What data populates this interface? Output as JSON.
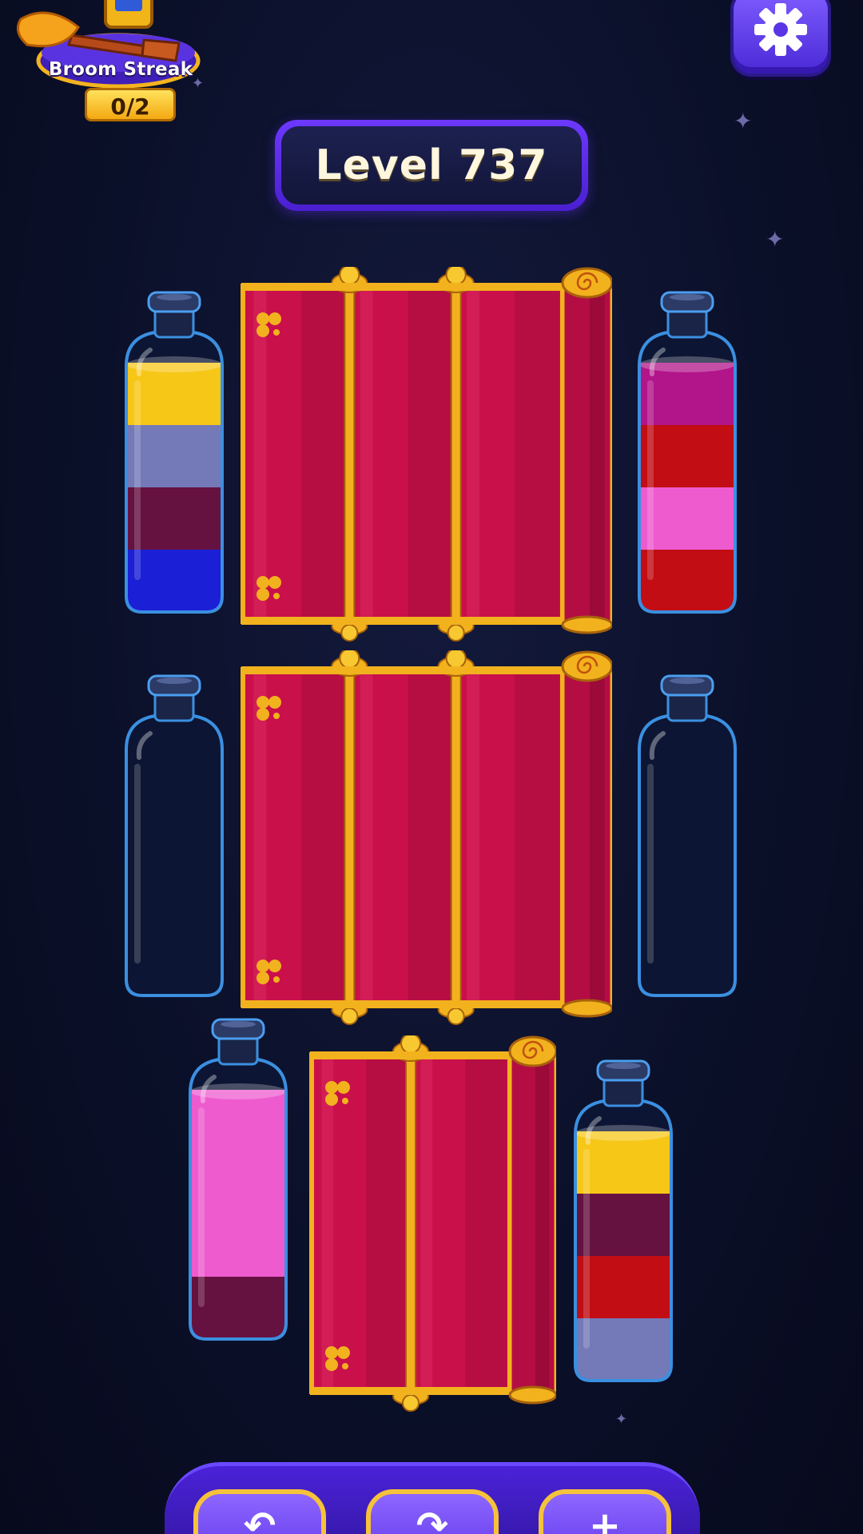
{
  "header": {
    "streak_label": "Broom Streak",
    "streak_count": "0/2",
    "level_label": "Level 737"
  },
  "icons": {
    "streak": "broom-icon",
    "settings": "gear-icon",
    "undo": "undo-arrow-icon",
    "shuffle": "redo-arrow-icon",
    "add": "add-bottle-icon"
  },
  "colors": {
    "yellow": "#f7c718",
    "lavender": "#7479b8",
    "plum": "#651240",
    "blue": "#1b1fd6",
    "magenta": "#b2148a",
    "red": "#c10d13",
    "pink": "#ee5bcf",
    "curtain": "#c9104a",
    "gold": "#f2b21e"
  },
  "bottles": [
    {
      "name": "bottle-top-left",
      "layers": [
        "yellow",
        "lavender",
        "plum",
        "blue"
      ]
    },
    {
      "name": "bottle-top-right",
      "layers": [
        "magenta",
        "red",
        "pink",
        "red"
      ]
    },
    {
      "name": "bottle-middle-left",
      "layers": []
    },
    {
      "name": "bottle-middle-right",
      "layers": []
    },
    {
      "name": "bottle-bottom-left",
      "layers": [
        "pink",
        "pink",
        "pink",
        "plum"
      ]
    },
    {
      "name": "bottle-bottom-right",
      "layers": [
        "yellow",
        "plum",
        "red",
        "lavender"
      ]
    }
  ]
}
